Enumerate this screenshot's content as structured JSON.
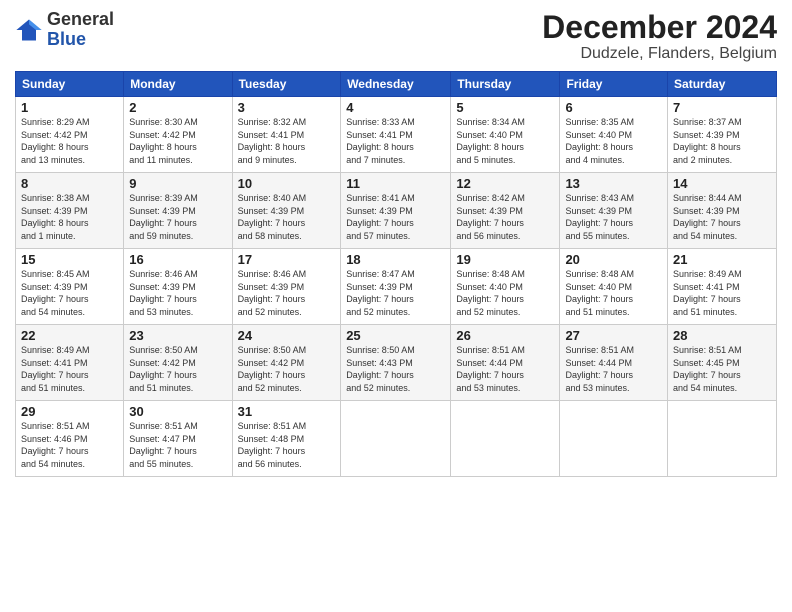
{
  "logo": {
    "text_general": "General",
    "text_blue": "Blue"
  },
  "title": "December 2024",
  "subtitle": "Dudzele, Flanders, Belgium",
  "days_header": [
    "Sunday",
    "Monday",
    "Tuesday",
    "Wednesday",
    "Thursday",
    "Friday",
    "Saturday"
  ],
  "weeks": [
    [
      {
        "day": "1",
        "info": "Sunrise: 8:29 AM\nSunset: 4:42 PM\nDaylight: 8 hours\nand 13 minutes."
      },
      {
        "day": "2",
        "info": "Sunrise: 8:30 AM\nSunset: 4:42 PM\nDaylight: 8 hours\nand 11 minutes."
      },
      {
        "day": "3",
        "info": "Sunrise: 8:32 AM\nSunset: 4:41 PM\nDaylight: 8 hours\nand 9 minutes."
      },
      {
        "day": "4",
        "info": "Sunrise: 8:33 AM\nSunset: 4:41 PM\nDaylight: 8 hours\nand 7 minutes."
      },
      {
        "day": "5",
        "info": "Sunrise: 8:34 AM\nSunset: 4:40 PM\nDaylight: 8 hours\nand 5 minutes."
      },
      {
        "day": "6",
        "info": "Sunrise: 8:35 AM\nSunset: 4:40 PM\nDaylight: 8 hours\nand 4 minutes."
      },
      {
        "day": "7",
        "info": "Sunrise: 8:37 AM\nSunset: 4:39 PM\nDaylight: 8 hours\nand 2 minutes."
      }
    ],
    [
      {
        "day": "8",
        "info": "Sunrise: 8:38 AM\nSunset: 4:39 PM\nDaylight: 8 hours\nand 1 minute."
      },
      {
        "day": "9",
        "info": "Sunrise: 8:39 AM\nSunset: 4:39 PM\nDaylight: 7 hours\nand 59 minutes."
      },
      {
        "day": "10",
        "info": "Sunrise: 8:40 AM\nSunset: 4:39 PM\nDaylight: 7 hours\nand 58 minutes."
      },
      {
        "day": "11",
        "info": "Sunrise: 8:41 AM\nSunset: 4:39 PM\nDaylight: 7 hours\nand 57 minutes."
      },
      {
        "day": "12",
        "info": "Sunrise: 8:42 AM\nSunset: 4:39 PM\nDaylight: 7 hours\nand 56 minutes."
      },
      {
        "day": "13",
        "info": "Sunrise: 8:43 AM\nSunset: 4:39 PM\nDaylight: 7 hours\nand 55 minutes."
      },
      {
        "day": "14",
        "info": "Sunrise: 8:44 AM\nSunset: 4:39 PM\nDaylight: 7 hours\nand 54 minutes."
      }
    ],
    [
      {
        "day": "15",
        "info": "Sunrise: 8:45 AM\nSunset: 4:39 PM\nDaylight: 7 hours\nand 54 minutes."
      },
      {
        "day": "16",
        "info": "Sunrise: 8:46 AM\nSunset: 4:39 PM\nDaylight: 7 hours\nand 53 minutes."
      },
      {
        "day": "17",
        "info": "Sunrise: 8:46 AM\nSunset: 4:39 PM\nDaylight: 7 hours\nand 52 minutes."
      },
      {
        "day": "18",
        "info": "Sunrise: 8:47 AM\nSunset: 4:39 PM\nDaylight: 7 hours\nand 52 minutes."
      },
      {
        "day": "19",
        "info": "Sunrise: 8:48 AM\nSunset: 4:40 PM\nDaylight: 7 hours\nand 52 minutes."
      },
      {
        "day": "20",
        "info": "Sunrise: 8:48 AM\nSunset: 4:40 PM\nDaylight: 7 hours\nand 51 minutes."
      },
      {
        "day": "21",
        "info": "Sunrise: 8:49 AM\nSunset: 4:41 PM\nDaylight: 7 hours\nand 51 minutes."
      }
    ],
    [
      {
        "day": "22",
        "info": "Sunrise: 8:49 AM\nSunset: 4:41 PM\nDaylight: 7 hours\nand 51 minutes."
      },
      {
        "day": "23",
        "info": "Sunrise: 8:50 AM\nSunset: 4:42 PM\nDaylight: 7 hours\nand 51 minutes."
      },
      {
        "day": "24",
        "info": "Sunrise: 8:50 AM\nSunset: 4:42 PM\nDaylight: 7 hours\nand 52 minutes."
      },
      {
        "day": "25",
        "info": "Sunrise: 8:50 AM\nSunset: 4:43 PM\nDaylight: 7 hours\nand 52 minutes."
      },
      {
        "day": "26",
        "info": "Sunrise: 8:51 AM\nSunset: 4:44 PM\nDaylight: 7 hours\nand 53 minutes."
      },
      {
        "day": "27",
        "info": "Sunrise: 8:51 AM\nSunset: 4:44 PM\nDaylight: 7 hours\nand 53 minutes."
      },
      {
        "day": "28",
        "info": "Sunrise: 8:51 AM\nSunset: 4:45 PM\nDaylight: 7 hours\nand 54 minutes."
      }
    ],
    [
      {
        "day": "29",
        "info": "Sunrise: 8:51 AM\nSunset: 4:46 PM\nDaylight: 7 hours\nand 54 minutes."
      },
      {
        "day": "30",
        "info": "Sunrise: 8:51 AM\nSunset: 4:47 PM\nDaylight: 7 hours\nand 55 minutes."
      },
      {
        "day": "31",
        "info": "Sunrise: 8:51 AM\nSunset: 4:48 PM\nDaylight: 7 hours\nand 56 minutes."
      },
      {
        "day": "",
        "info": ""
      },
      {
        "day": "",
        "info": ""
      },
      {
        "day": "",
        "info": ""
      },
      {
        "day": "",
        "info": ""
      }
    ]
  ]
}
